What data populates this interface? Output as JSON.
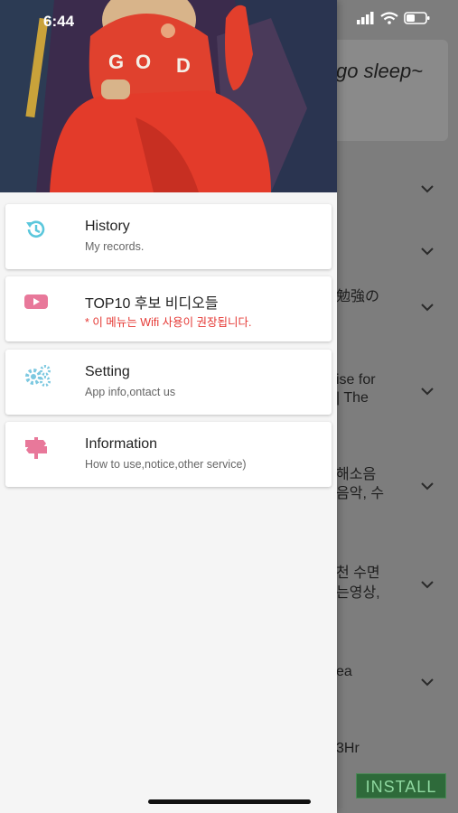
{
  "status_bar": {
    "time": "6:44"
  },
  "background_app": {
    "card_text": "go sleep~",
    "rows": [
      "勉強の",
      "ise for",
      "| The",
      "해소음",
      "음악, 수",
      "천 수면",
      "는영상,",
      "ea",
      "3Hr"
    ],
    "install_label": "INSTALL"
  },
  "drawer": {
    "header_image": "baby-in-red-hoodie-illustration",
    "items": [
      {
        "icon": "history-icon",
        "title": "History",
        "subtitle": "My records."
      },
      {
        "icon": "youtube-icon",
        "title": "TOP10 후보 비디오들",
        "subtitle": "* 이 메뉴는 Wifi 사용이 권장됩니다."
      },
      {
        "icon": "gears-icon",
        "title": "Setting",
        "subtitle": "App info,ontact us"
      },
      {
        "icon": "signpost-icon",
        "title": "Information",
        "subtitle": "How to use,notice,other service)"
      }
    ]
  },
  "colors": {
    "history_icon": "#5bc7dc",
    "youtube_icon": "#e8789a",
    "gears_icon": "#7cc8e0",
    "signpost_icon": "#e8789a",
    "warning_text": "#e53935",
    "install_bg": "#2e6a3a"
  }
}
